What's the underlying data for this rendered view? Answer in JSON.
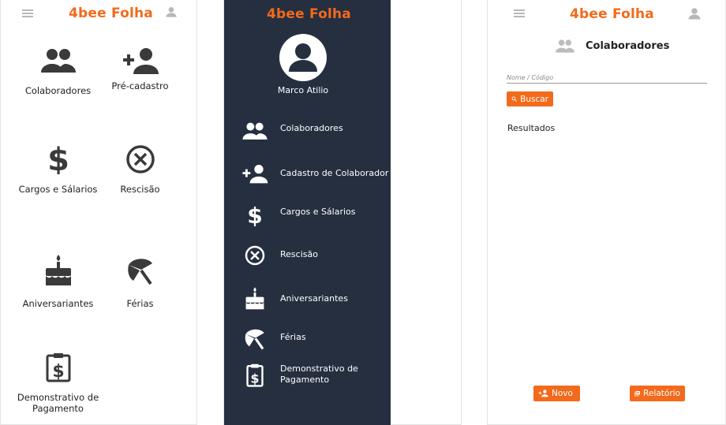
{
  "app": {
    "brand": "4bee Folha",
    "brand_color": "#f26a1b",
    "drawer_color": "#252f40"
  },
  "home": {
    "tiles": [
      {
        "label": "Colaboradores",
        "icon": "people-icon"
      },
      {
        "label": "Pré-cadastro",
        "icon": "person-add-icon"
      },
      {
        "label": "Cargos e Sálarios",
        "icon": "dollar-icon"
      },
      {
        "label": "Rescisão",
        "icon": "cancel-circle-icon"
      },
      {
        "label": "Aniversariantes",
        "icon": "cake-icon"
      },
      {
        "label": "Férias",
        "icon": "beach-umbrella-icon"
      },
      {
        "label": "Demonstrativo de Pagamento",
        "icon": "clipboard-dollar-icon"
      }
    ]
  },
  "drawer": {
    "user_name": "Marco Atilio",
    "items": [
      {
        "label": "Colaboradores",
        "icon": "people-icon"
      },
      {
        "label": "Cadastro de Colaborador",
        "icon": "person-add-icon"
      },
      {
        "label": "Cargos e Sálarios",
        "icon": "dollar-icon"
      },
      {
        "label": "Rescisão",
        "icon": "cancel-circle-icon"
      },
      {
        "label": "Aniversariantes",
        "icon": "cake-icon"
      },
      {
        "label": "Férias",
        "icon": "beach-umbrella-icon"
      },
      {
        "label": "Demonstrativo de",
        "label2": "Pagamento",
        "icon": "clipboard-dollar-icon"
      }
    ]
  },
  "search_page": {
    "title": "Colaboradores",
    "search_placeholder": "Nome / Código",
    "search_button": "Buscar",
    "results_label": "Resultados",
    "new_button": "Novo",
    "report_button": "Relatório"
  }
}
